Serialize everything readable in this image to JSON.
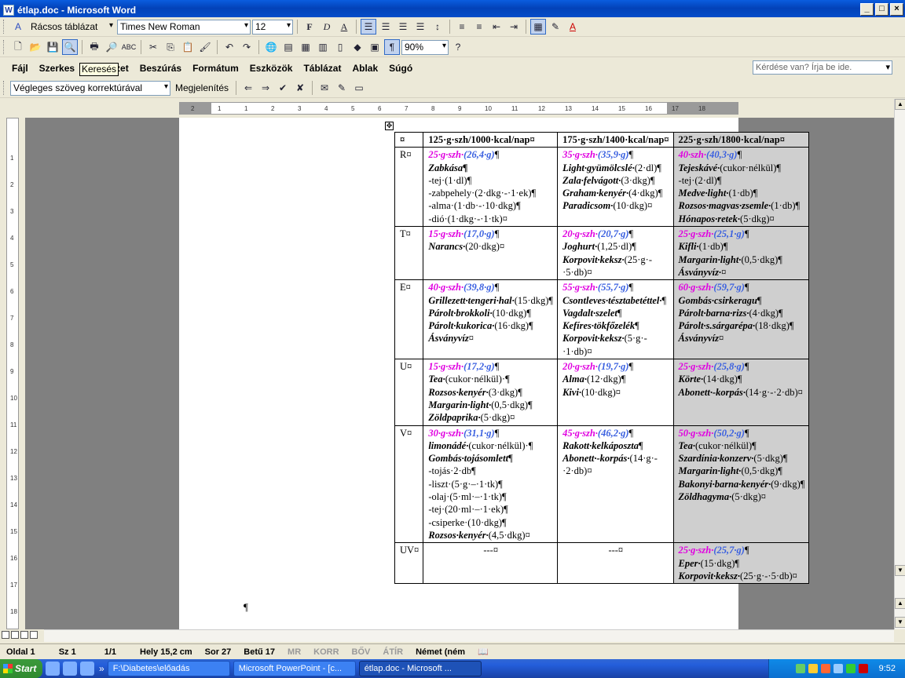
{
  "window": {
    "title": "étlap.doc - Microsoft Word"
  },
  "toolbar1": {
    "style": "Rácsos táblázat",
    "font": "Times New Roman",
    "size": "12",
    "bold": "F",
    "italic": "D",
    "underline": "A"
  },
  "toolbar2": {
    "zoom": "90%"
  },
  "menu": {
    "items": [
      "Fájl",
      "Szerkes",
      "zet",
      "Beszúrás",
      "Formátum",
      "Eszközök",
      "Táblázat",
      "Ablak",
      "Súgó"
    ],
    "ask": "Kérdése van? Írja be ide.",
    "tooltip": "Keresés"
  },
  "toolbar3": {
    "review": "Végleges szöveg korrektúrával",
    "show": "Megjelenítés"
  },
  "ruler": {
    "ticks": [
      "2",
      "1",
      "1",
      "2",
      "3",
      "4",
      "5",
      "6",
      "7",
      "8",
      "9",
      "10",
      "11",
      "12",
      "13",
      "14",
      "15",
      "16",
      "17",
      "18"
    ],
    "vticks": [
      "1",
      "2",
      "3",
      "4",
      "5",
      "6",
      "7",
      "8",
      "9",
      "10",
      "11",
      "12",
      "13",
      "14",
      "15",
      "16",
      "17",
      "18"
    ]
  },
  "table": {
    "headers": [
      "¤",
      "125·g·szh/1000·kcal/nap¤",
      "175·g·szh/1400·kcal/nap¤",
      "225·g·szh/1800·kcal/nap¤"
    ],
    "rows": [
      {
        "day": "R¤",
        "cells": [
          [
            {
              "k": "kc",
              "m": "25·g·szh·",
              "b": "(26,4·g)",
              "t": "¶"
            },
            {
              "k": "food",
              "t": "Zabkása¶"
            },
            {
              "k": "plain",
              "t": "-tej·(1·dl)¶"
            },
            {
              "k": "plain",
              "t": "-zabpehely·(2·dkg·-·1·ek)¶"
            },
            {
              "k": "plain",
              "t": "-alma·(1·db·-·10·dkg)¶"
            },
            {
              "k": "plain",
              "t": "-dió·(1·dkg·-·1·tk)¤"
            }
          ],
          [
            {
              "k": "kc",
              "m": "35·g·szh·",
              "b": "(35,9·g)",
              "t": "¶"
            },
            {
              "k": "food",
              "t": "Light·gyümölcslé·",
              "p": "(2·dl)¶"
            },
            {
              "k": "food",
              "t": "Zala·felvágott·",
              "p": "(3·dkg)¶"
            },
            {
              "k": "food",
              "t": "Graham·kenyér·",
              "p": "(4·dkg)¶"
            },
            {
              "k": "food",
              "t": "Paradicsom·",
              "p": "(10·dkg)¤"
            }
          ],
          [
            {
              "k": "kc",
              "m": "40·szh·",
              "b": "(40,3·g)",
              "t": "¶"
            },
            {
              "k": "food",
              "t": "Tejeskávé·",
              "p": "(cukor·nélkül)¶"
            },
            {
              "k": "plain",
              "t": "-tej·(2·dl)¶"
            },
            {
              "k": "food",
              "t": "Medve·light·",
              "p": "(1·db)¶"
            },
            {
              "k": "food",
              "t": "Rozsos·magvas·zsemle·",
              "p": "(1·db)¶"
            },
            {
              "k": "food",
              "t": "Hónapos·retek·",
              "p": "(5·dkg)¤"
            }
          ]
        ]
      },
      {
        "day": "T¤",
        "cells": [
          [
            {
              "k": "kc",
              "m": "15·g·szh·",
              "b": "(17,0·g)",
              "t": "¶"
            },
            {
              "k": "food",
              "t": "Narancs·",
              "p": "(20·dkg)¤"
            }
          ],
          [
            {
              "k": "kc",
              "m": "20·g·szh·",
              "b": "(20,7·g)",
              "t": "¶"
            },
            {
              "k": "food",
              "t": "Joghurt·",
              "p": "(1,25·dl)¶"
            },
            {
              "k": "food",
              "t": "Korpovit·keksz·",
              "p": "(25·g·-·5·db)¤"
            }
          ],
          [
            {
              "k": "kc",
              "m": "25·g·szh·",
              "b": "(25,1·g)",
              "t": "¶"
            },
            {
              "k": "food",
              "t": "Kifli·",
              "p": "(1·db)¶"
            },
            {
              "k": "food",
              "t": "Margarin·light·",
              "p": "(0,5·dkg)¶"
            },
            {
              "k": "food",
              "t": "Ásványvíz·",
              "p": "¤"
            }
          ]
        ]
      },
      {
        "day": "E¤",
        "cells": [
          [
            {
              "k": "kc",
              "m": "40·g·szh·",
              "b": "(39,8·g)",
              "t": "¶"
            },
            {
              "k": "food",
              "t": "Grillezett·tengeri·hal·",
              "p": "(15·dkg)¶"
            },
            {
              "k": "food",
              "t": "Párolt·brokkoli·",
              "p": "(10·dkg)¶"
            },
            {
              "k": "food",
              "t": "Párolt·kukorica·",
              "p": "(16·dkg)¶"
            },
            {
              "k": "food",
              "t": "Ásványvíz",
              "p": "¤"
            }
          ],
          [
            {
              "k": "kc",
              "m": "55·g·szh·",
              "b": "(55,7·g)",
              "t": "¶"
            },
            {
              "k": "food",
              "t": "Csontleves·tésztabetéttel·",
              "p": "¶"
            },
            {
              "k": "food",
              "t": "Vagdalt·szelet",
              "p": "¶"
            },
            {
              "k": "food",
              "t": "Kefíres·tökfőzelék",
              "p": "¶"
            },
            {
              "k": "food",
              "t": "Korpovit·keksz·",
              "p": "(5·g·-·1·db)¤"
            }
          ],
          [
            {
              "k": "kc",
              "m": "60·g·szh·",
              "b": "(59,7·g)",
              "t": "¶"
            },
            {
              "k": "food",
              "t": "Gombás·csirkeragu",
              "p": "¶"
            },
            {
              "k": "food",
              "t": "Párolt·barna·rizs·",
              "p": "(4·dkg)¶"
            },
            {
              "k": "food",
              "t": "Párolt·s.sárgarépa·",
              "p": "(18·dkg)¶"
            },
            {
              "k": "food",
              "t": "Ásványvíz",
              "p": "¤"
            }
          ]
        ]
      },
      {
        "day": "U¤",
        "cells": [
          [
            {
              "k": "kc",
              "m": "15·g·szh·",
              "b": "(17,2·g)",
              "t": "¶"
            },
            {
              "k": "food",
              "t": "Tea·",
              "p": "(cukor·nélkül)·¶"
            },
            {
              "k": "food",
              "t": "Rozsos·kenyér·",
              "p": "(3·dkg)¶"
            },
            {
              "k": "food",
              "t": "Margarin·light·",
              "p": "(0,5·dkg)¶"
            },
            {
              "k": "food",
              "t": "Zöldpaprika·",
              "p": "(5·dkg)¤"
            }
          ],
          [
            {
              "k": "kc",
              "m": "20·g·szh·",
              "b": "(19,7·g)",
              "t": "¶"
            },
            {
              "k": "food",
              "t": "Alma·",
              "p": "(12·dkg)¶"
            },
            {
              "k": "food",
              "t": "Kivi·",
              "p": "(10·dkg)¤"
            }
          ],
          [
            {
              "k": "kc",
              "m": "25·g·szh·",
              "b": "(25,8·g)",
              "t": "¶"
            },
            {
              "k": "food",
              "t": "Körte·",
              "p": "(14·dkg)¶"
            },
            {
              "k": "food",
              "t": "Abonett·-korpás·",
              "p": "(14·g·-·2·db)¤"
            }
          ]
        ]
      },
      {
        "day": "V¤",
        "cells": [
          [
            {
              "k": "kc",
              "m": "30·g·szh·",
              "b": "(31,1·g)",
              "t": "¶"
            },
            {
              "k": "food",
              "t": "limonádé·",
              "p": "(cukor·nélkül)·¶"
            },
            {
              "k": "food",
              "t": "Gombás·tojásomlett",
              "p": "¶"
            },
            {
              "k": "plain",
              "t": "-tojás·2·db¶"
            },
            {
              "k": "plain",
              "t": "-liszt·(5·g·–·1·tk)¶"
            },
            {
              "k": "plain",
              "t": "-olaj·(5·ml·–·1·tk)¶"
            },
            {
              "k": "plain",
              "t": "-tej·(20·ml·–·1·ek)¶"
            },
            {
              "k": "plain",
              "t": "-csiperke·(10·dkg)¶"
            },
            {
              "k": "food",
              "t": "Rozsos·kenyér·",
              "p": "(4,5·dkg)¤"
            }
          ],
          [
            {
              "k": "kc",
              "m": "45·g·szh·",
              "b": "(46,2·g)",
              "t": "¶"
            },
            {
              "k": "food",
              "t": "Rakott·kelkáposzta",
              "p": "¶"
            },
            {
              "k": "food",
              "t": "Abonett·-korpás·",
              "p": "(14·g·-·2·db)¤"
            }
          ],
          [
            {
              "k": "kc",
              "m": "50·g·szh·",
              "b": "(50,2·g)",
              "t": "¶"
            },
            {
              "k": "food",
              "t": "Tea·",
              "p": "(cukor·nélkül)¶"
            },
            {
              "k": "food",
              "t": "Szardínia·konzerv·",
              "p": "(5·dkg)¶"
            },
            {
              "k": "food",
              "t": "Margarin·light·",
              "p": "(0,5·dkg)¶"
            },
            {
              "k": "food",
              "t": "Bakonyi·barna·kenyér·",
              "p": "(9·dkg)¶"
            },
            {
              "k": "food",
              "t": "Zöldhagyma·",
              "p": "(5·dkg)¤"
            }
          ]
        ]
      },
      {
        "day": "UV¤",
        "cells": [
          [
            {
              "k": "center",
              "t": "---¤"
            }
          ],
          [
            {
              "k": "center",
              "t": "---¤"
            }
          ],
          [
            {
              "k": "kc",
              "m": "25·g·szh·",
              "b": "(25,7·g)",
              "t": "¶"
            },
            {
              "k": "food",
              "t": "Eper·",
              "p": "(15·dkg)¶"
            },
            {
              "k": "food",
              "t": "Korpovit·keksz·",
              "p": "(25·g·-·5·db)¤"
            }
          ]
        ]
      }
    ],
    "after": "¶"
  },
  "status": {
    "oldal": "Oldal  1",
    "sz": "Sz  1",
    "pages": "1/1",
    "hely": "Hely  15,2 cm",
    "sor": "Sor  27",
    "betu": "Betű  17",
    "mr": "MR",
    "korr": "KORR",
    "bov": "BŐV",
    "atir": "ÁTÍR",
    "lang": "Német (ném"
  },
  "taskbar": {
    "start": "Start",
    "tasks": [
      "F:\\Diabetes\\előadás",
      "Microsoft PowerPoint - [c...",
      "étlap.doc - Microsoft ..."
    ],
    "clock": "9:52"
  }
}
